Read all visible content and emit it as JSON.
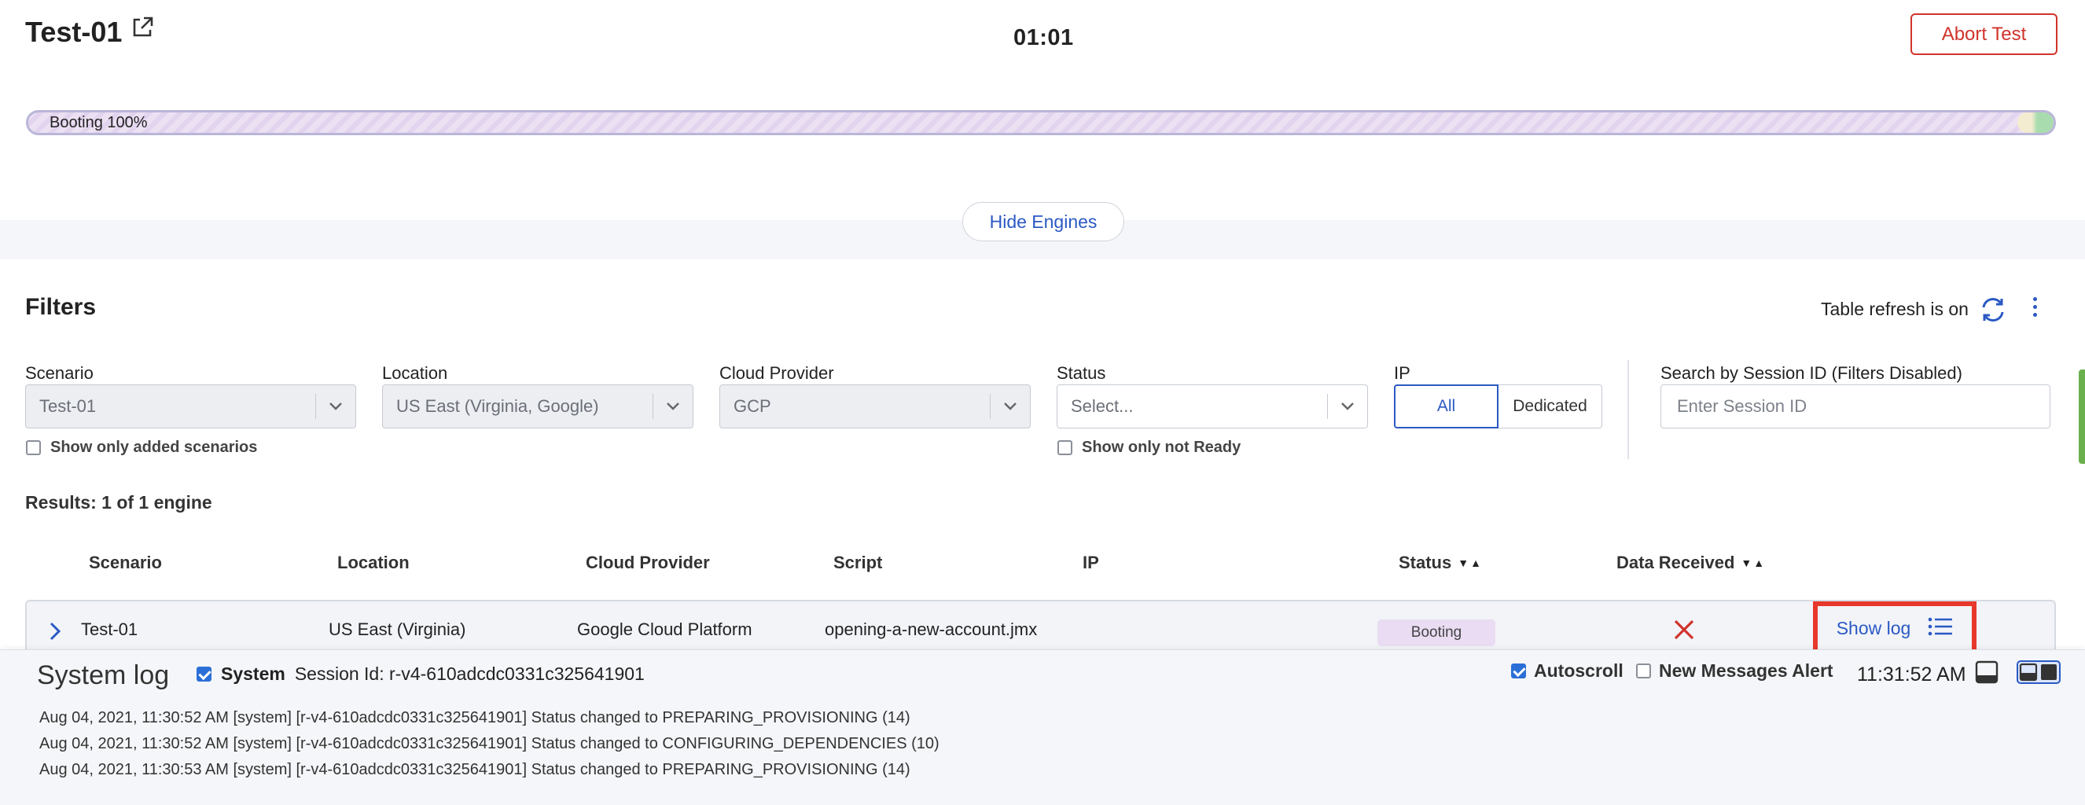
{
  "header": {
    "title": "Test-01",
    "timer": "01:01",
    "abort_label": "Abort Test"
  },
  "progress": {
    "label": "Booting 100%",
    "value_percent": 100
  },
  "hide_engines_label": "Hide Engines",
  "filters": {
    "title": "Filters",
    "refresh_text": "Table refresh is on",
    "scenario": {
      "label": "Scenario",
      "value": "Test-01"
    },
    "location": {
      "label": "Location",
      "value": "US East (Virginia, Google)"
    },
    "cloud_provider": {
      "label": "Cloud Provider",
      "value": "GCP"
    },
    "status": {
      "label": "Status",
      "placeholder": "Select..."
    },
    "ip": {
      "label": "IP",
      "options": [
        "All",
        "Dedicated"
      ],
      "selected": "All"
    },
    "session_search": {
      "label": "Search by Session ID (Filters Disabled)",
      "placeholder": "Enter Session ID"
    },
    "show_only_added": "Show only added scenarios",
    "show_only_not_ready": "Show only not Ready"
  },
  "results_text": "Results: 1 of 1 engine",
  "table": {
    "columns": [
      "Scenario",
      "Location",
      "Cloud Provider",
      "Script",
      "IP",
      "Status",
      "Data Received"
    ],
    "sort_glyphs": "▼▲",
    "rows": [
      {
        "scenario": "Test-01",
        "location": "US East (Virginia)",
        "cloud_provider": "Google Cloud Platform",
        "script": "opening-a-new-account.jmx",
        "ip": "",
        "status": "Booting",
        "data_received": "x-icon",
        "action": "Show log"
      }
    ]
  },
  "system_log": {
    "title": "System log",
    "system_label": "System",
    "session_text": "Session Id: r-v4-610adcdc0331c325641901",
    "autoscroll_label": "Autoscroll",
    "new_messages_label": "New Messages Alert",
    "time": "11:31:52 AM",
    "lines": [
      "Aug 04, 2021, 11:30:52 AM  [system]   [r-v4-610adcdc0331c325641901]  Status changed to PREPARING_PROVISIONING (14)",
      "Aug 04, 2021, 11:30:52 AM  [system]   [r-v4-610adcdc0331c325641901]  Status changed to CONFIGURING_DEPENDENCIES (10)",
      "Aug 04, 2021, 11:30:53 AM  [system]   [r-v4-610adcdc0331c325641901]  Status changed to PREPARING_PROVISIONING (14)"
    ]
  },
  "colors": {
    "accent": "#2b59c3",
    "danger": "#d0342c",
    "highlight_box": "#e8382c",
    "booting_badge": "#eadcf3"
  }
}
